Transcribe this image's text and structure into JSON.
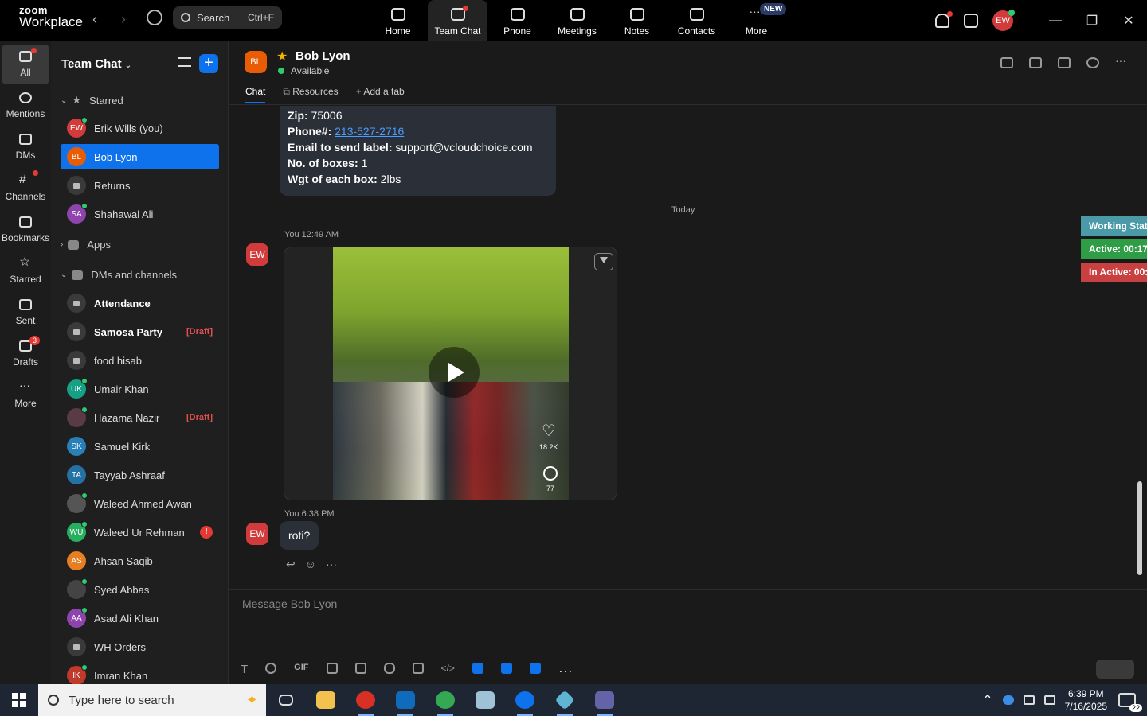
{
  "app": {
    "brand_top": "zoom",
    "brand_bottom": "Workplace"
  },
  "search": {
    "label": "Search",
    "shortcut": "Ctrl+F"
  },
  "nav_tabs": [
    {
      "label": "Home"
    },
    {
      "label": "Team Chat"
    },
    {
      "label": "Phone"
    },
    {
      "label": "Meetings"
    },
    {
      "label": "Notes"
    },
    {
      "label": "Contacts"
    },
    {
      "label": "More",
      "badge": "NEW"
    }
  ],
  "user": {
    "initials": "EW"
  },
  "rail": [
    {
      "label": "All"
    },
    {
      "label": "Mentions"
    },
    {
      "label": "DMs"
    },
    {
      "label": "Channels"
    },
    {
      "label": "Bookmarks"
    },
    {
      "label": "Starred"
    },
    {
      "label": "Sent"
    },
    {
      "label": "Drafts",
      "badge": "3"
    },
    {
      "label": "More"
    }
  ],
  "sidebar": {
    "title": "Team Chat",
    "starred_label": "Starred",
    "apps_label": "Apps",
    "dms_label": "DMs and channels",
    "starred": [
      {
        "initials": "EW",
        "name": "Erik Wills (you)",
        "color": "#d13b3b"
      },
      {
        "initials": "BL",
        "name": "Bob Lyon",
        "color": "#e85d04"
      },
      {
        "initials": "",
        "name": "Returns",
        "color": "#3a3a3a"
      },
      {
        "initials": "SA",
        "name": "Shahawal Ali",
        "color": "#8e44ad"
      }
    ],
    "channels": [
      {
        "initials": "",
        "name": "Attendance",
        "draft": ""
      },
      {
        "initials": "",
        "name": "Samosa Party",
        "draft": "[Draft]"
      },
      {
        "initials": "",
        "name": "food hisab",
        "draft": ""
      },
      {
        "initials": "UK",
        "name": "Umair Khan",
        "draft": ""
      },
      {
        "initials": "",
        "name": "Hazama Nazir",
        "draft": "[Draft]"
      },
      {
        "initials": "SK",
        "name": "Samuel Kirk",
        "draft": ""
      },
      {
        "initials": "TA",
        "name": "Tayyab Ashraaf",
        "draft": ""
      },
      {
        "initials": "",
        "name": "Waleed Ahmed Awan",
        "draft": ""
      },
      {
        "initials": "WU",
        "name": "Waleed Ur Rehman",
        "draft": "",
        "alert": "!"
      },
      {
        "initials": "AS",
        "name": "Ahsan Saqib",
        "draft": ""
      },
      {
        "initials": "",
        "name": "Syed Abbas",
        "draft": ""
      },
      {
        "initials": "AA",
        "name": "Asad Ali Khan",
        "draft": ""
      },
      {
        "initials": "",
        "name": "WH Orders",
        "draft": ""
      },
      {
        "initials": "IK",
        "name": "Imran Khan",
        "draft": ""
      }
    ]
  },
  "chat": {
    "contact_initials": "BL",
    "contact_name": "Bob Lyon",
    "status": "Available",
    "tabs": [
      "Chat",
      "Resources",
      "Add a tab"
    ],
    "old_message": {
      "zip_label": "Zip:",
      "zip": "75006",
      "phone_label": "Phone#:",
      "phone": "213-527-2716",
      "email_label": "Email to send label:",
      "email": "support@vcloudchoice.com",
      "boxes_label": "No. of boxes:",
      "boxes": "1",
      "weight_label": "Wgt of each box:",
      "weight": "2lbs"
    },
    "divider": "Today",
    "video_msg": {
      "meta": "You 12:49 AM",
      "likes": "18.2K",
      "comments": "77"
    },
    "text_msg": {
      "meta": "You 6:38 PM",
      "text": "roti?"
    },
    "composer_placeholder": "Message Bob Lyon"
  },
  "work_status": {
    "title": "Working Stat",
    "active": "Active: 00:17",
    "inactive": "In Active: 00:"
  },
  "taskbar": {
    "search_placeholder": "Type here to search",
    "time": "6:39 PM",
    "date": "7/16/2025",
    "notifications": "22"
  }
}
